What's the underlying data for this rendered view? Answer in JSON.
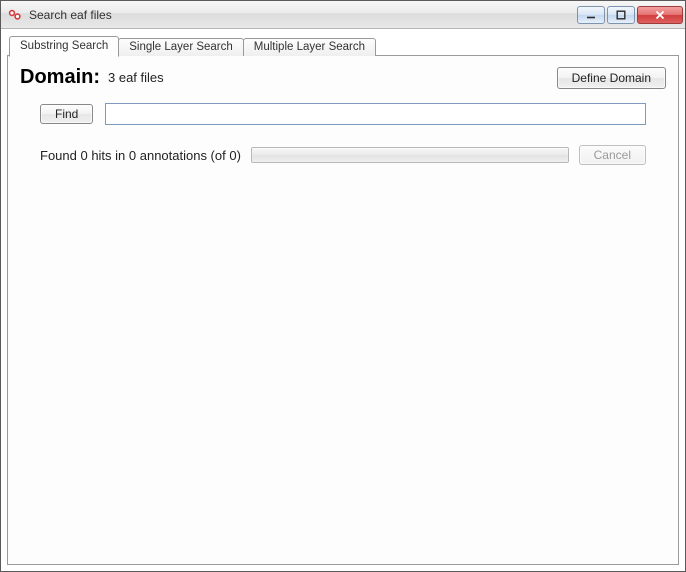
{
  "window": {
    "title": "Search eaf files"
  },
  "tabs": [
    {
      "label": "Substring Search",
      "active": true
    },
    {
      "label": "Single Layer Search",
      "active": false
    },
    {
      "label": "Multiple Layer Search",
      "active": false
    }
  ],
  "domain": {
    "label": "Domain:",
    "value": "3 eaf files",
    "define_button": "Define Domain"
  },
  "search": {
    "find_button": "Find",
    "input_value": "",
    "placeholder": ""
  },
  "results": {
    "status_text": "Found 0 hits in 0 annotations (of 0)",
    "cancel_button": "Cancel",
    "progress_percent": 0
  }
}
